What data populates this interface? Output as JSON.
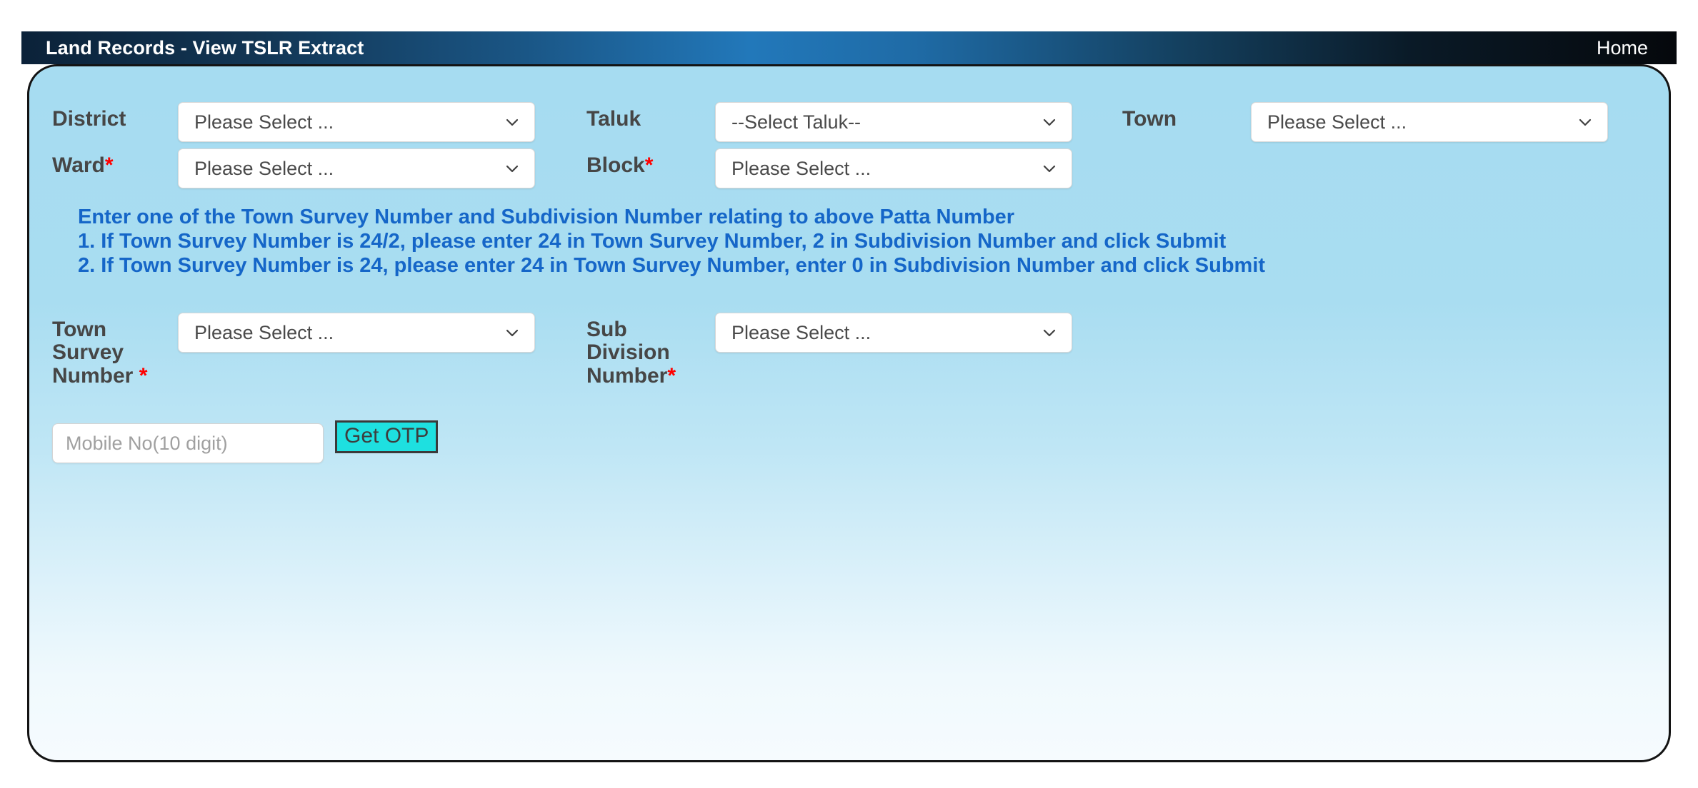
{
  "header": {
    "title": "Land Records - View TSLR Extract",
    "home_label": "Home"
  },
  "form": {
    "district": {
      "label": "District",
      "value": "Please Select ...",
      "required": false
    },
    "taluk": {
      "label": "Taluk",
      "value": "--Select Taluk--",
      "required": false
    },
    "town": {
      "label": "Town",
      "value": "Please Select ...",
      "required": false
    },
    "ward": {
      "label": "Ward",
      "star": "*",
      "value": "Please Select ..."
    },
    "block": {
      "label": "Block",
      "star": "*",
      "value": "Please Select ..."
    },
    "town_survey_number": {
      "label": "Town Survey Number",
      "star": "*",
      "value": "Please Select ..."
    },
    "sub_division_number": {
      "label": "Sub Division Number",
      "star": "*",
      "value": "Please Select ..."
    },
    "mobile": {
      "placeholder": "Mobile No(10 digit)",
      "value": ""
    },
    "get_otp_label": "Get OTP"
  },
  "instructions": {
    "line0": "Enter one of the Town Survey Number and Subdivision Number relating to above Patta Number",
    "line1": "1. If Town Survey Number is 24/2, please enter 24 in Town Survey Number, 2 in Subdivision Number and click Submit",
    "line2": "2. If Town Survey Number is 24, please enter 24 in Town Survey Number, enter 0 in Subdivision Number and click Submit"
  },
  "colors": {
    "instruction_blue": "#1566c8",
    "required_star_red": "#ff0000",
    "label_gray": "#464646",
    "otp_button_cyan": "#1ee0e0",
    "card_top_blue": "#a6dcf1",
    "header_gradient_mid": "#2278ba"
  },
  "icons": {
    "chevron": "chevron-down-icon"
  }
}
